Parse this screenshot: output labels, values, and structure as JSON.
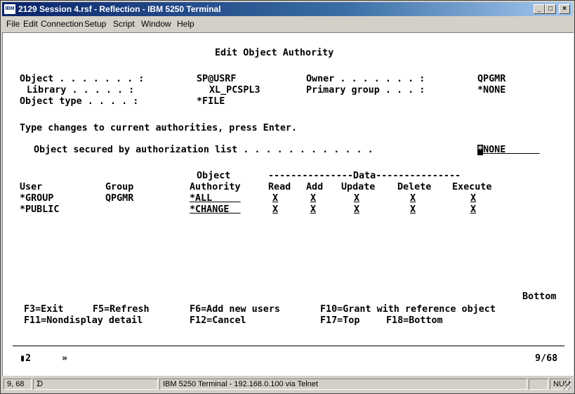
{
  "window": {
    "icon_text": "IBM",
    "title": "2129 Session 4.rsf - Reflection - IBM 5250 Terminal",
    "minimize": "_",
    "maximize": "□",
    "close": "×"
  },
  "menu": [
    "File",
    "Edit",
    "Connection",
    "Setup",
    "Script",
    "Window",
    "Help"
  ],
  "screen": {
    "heading": "Edit Object Authority",
    "object_label": "Object . . . . . . . :",
    "object_value": "SP@USRF",
    "library_label": "Library . . . . . :",
    "library_value": "XL_PCSPL3",
    "object_type_label": "Object type . . . . :",
    "object_type_value": "*FILE",
    "owner_label": "Owner . . . . . . . :",
    "owner_value": "QPGMR",
    "primary_group_label": "Primary group . . . :",
    "primary_group_value": "*NONE",
    "instruction": "Type changes to current authorities, press Enter.",
    "auth_list_label": "Object secured by authorization list . . . . . . . . . . . .",
    "auth_list_cursor": "*",
    "auth_list_value": "NONE",
    "header_object": "Object",
    "header_data": "---------------Data---------------",
    "columns": [
      "User",
      "Group",
      "Authority",
      "Read",
      "Add",
      "Update",
      "Delete",
      "Execute"
    ],
    "rows": [
      {
        "user": "*GROUP",
        "group": "QPGMR",
        "authority": "*ALL",
        "read": "X",
        "add": "X",
        "update": "X",
        "delete": "X",
        "execute": "X"
      },
      {
        "user": "*PUBLIC",
        "group": "",
        "authority": "*CHANGE",
        "read": "X",
        "add": "X",
        "update": "X",
        "delete": "X",
        "execute": "X"
      }
    ],
    "bottom_label": "Bottom",
    "fkeys_line1": [
      "F3=Exit",
      "F5=Refresh",
      "F6=Add new users",
      "F10=Grant with reference object"
    ],
    "fkeys_line2": [
      "F11=Nondisplay detail",
      "F12=Cancel",
      "F17=Top",
      "F18=Bottom"
    ]
  },
  "oia": {
    "indicator": "▮2",
    "arrow": "»",
    "position": "9/68"
  },
  "statusbar": {
    "cursor_pos": "9, 68",
    "icon": "ᗤ",
    "connection": "IBM 5250 Terminal - 192.168.0.100 via Telnet",
    "num": "NUM"
  }
}
